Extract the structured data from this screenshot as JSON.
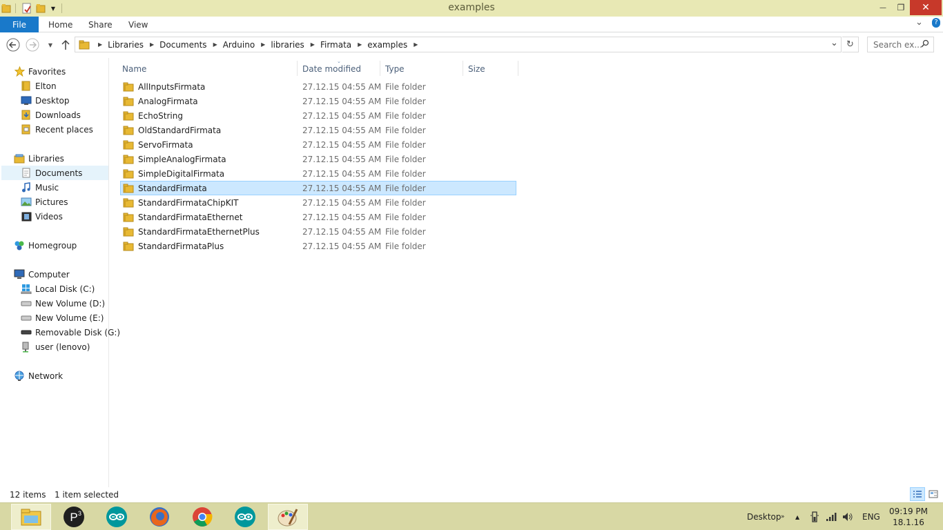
{
  "window": {
    "title": "examples",
    "close_glyph": "✕",
    "maximize_glyph": "❐",
    "minimize_glyph": "—"
  },
  "ribbon": {
    "tabs": [
      "File",
      "Home",
      "Share",
      "View"
    ],
    "expand_glyph": "⌄",
    "help_glyph": "?"
  },
  "address": {
    "crumbs": [
      "Libraries",
      "Documents",
      "Arduino",
      "libraries",
      "Firmata",
      "examples"
    ],
    "dropdown_glyph": "⌄",
    "refresh_glyph": "↻"
  },
  "search": {
    "placeholder": "Search ex..."
  },
  "nav_pane": {
    "favorites": {
      "label": "Favorites",
      "items": [
        "Elton",
        "Desktop",
        "Downloads",
        "Recent places"
      ]
    },
    "libraries": {
      "label": "Libraries",
      "items": [
        "Documents",
        "Music",
        "Pictures",
        "Videos"
      ]
    },
    "homegroup": "Homegroup",
    "computer": {
      "label": "Computer",
      "items": [
        "Local Disk (C:)",
        "New Volume (D:)",
        "New Volume (E:)",
        "Removable Disk (G:)",
        "user (lenovo)"
      ]
    },
    "network": "Network"
  },
  "columns": {
    "name": "Name",
    "date": "Date modified",
    "type": "Type",
    "size": "Size"
  },
  "files": [
    {
      "name": "AllInputsFirmata",
      "date": "27.12.15 04:55 AM",
      "type": "File folder"
    },
    {
      "name": "AnalogFirmata",
      "date": "27.12.15 04:55 AM",
      "type": "File folder"
    },
    {
      "name": "EchoString",
      "date": "27.12.15 04:55 AM",
      "type": "File folder"
    },
    {
      "name": "OldStandardFirmata",
      "date": "27.12.15 04:55 AM",
      "type": "File folder"
    },
    {
      "name": "ServoFirmata",
      "date": "27.12.15 04:55 AM",
      "type": "File folder"
    },
    {
      "name": "SimpleAnalogFirmata",
      "date": "27.12.15 04:55 AM",
      "type": "File folder"
    },
    {
      "name": "SimpleDigitalFirmata",
      "date": "27.12.15 04:55 AM",
      "type": "File folder"
    },
    {
      "name": "StandardFirmata",
      "date": "27.12.15 04:55 AM",
      "type": "File folder",
      "selected": true
    },
    {
      "name": "StandardFirmataChipKIT",
      "date": "27.12.15 04:55 AM",
      "type": "File folder"
    },
    {
      "name": "StandardFirmataEthernet",
      "date": "27.12.15 04:55 AM",
      "type": "File folder"
    },
    {
      "name": "StandardFirmataEthernetPlus",
      "date": "27.12.15 04:55 AM",
      "type": "File folder"
    },
    {
      "name": "StandardFirmataPlus",
      "date": "27.12.15 04:55 AM",
      "type": "File folder"
    }
  ],
  "status": {
    "item_count": "12 items",
    "selection": "1 item selected"
  },
  "taskbar": {
    "apps": [
      "file-explorer-icon",
      "processing-icon",
      "arduino-icon",
      "firefox-icon",
      "chrome-icon",
      "arduino-icon",
      "paint-icon"
    ],
    "desktop_label": "Desktop",
    "language": "ENG",
    "time": "09:19 PM",
    "date": "18.1.16"
  },
  "colors": {
    "titlebar": "#e8e8b4",
    "file_tab": "#1979ca",
    "selection": "#cce8ff",
    "selection_border": "#99d1ff",
    "close_button": "#c7392a",
    "taskbar": "#d8d8a4"
  }
}
